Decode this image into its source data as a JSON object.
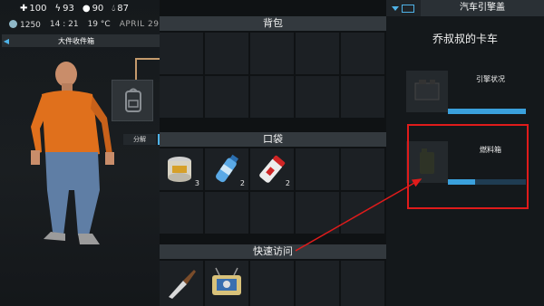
{
  "hud": {
    "health": "100",
    "energy": "93",
    "food": "90",
    "water": "87",
    "coins": "1250",
    "time": "14 : 21",
    "temperature": "19 °C",
    "date": "APRIL 29"
  },
  "icons": {
    "health": "plus-icon",
    "energy": "lightning-icon",
    "food": "apple-icon",
    "water": "water-drop-icon",
    "coins": "coin-icon"
  },
  "left": {
    "container_label": "大件收件箱",
    "split_label": "分解"
  },
  "inventory": {
    "backpack_title": "背包",
    "pockets_title": "口袋",
    "pockets_items": [
      {
        "name": "canned-food",
        "qty": "3"
      },
      {
        "name": "water-bottle",
        "qty": "2"
      },
      {
        "name": "spray-can",
        "qty": "2"
      }
    ],
    "quick_access_title": "快速访问",
    "quick_items": [
      "knife",
      "radio"
    ]
  },
  "vehicle": {
    "tab_title": "汽车引擎盖",
    "truck_name": "乔叔叔的卡车",
    "parts": [
      {
        "name": "引擎状况",
        "level": 1.0
      },
      {
        "name": "燃料箱",
        "level": 0.35
      }
    ]
  },
  "colors": {
    "accent": "#4fb3e8",
    "highlight": "#e01b1b",
    "panel": "#1c2024"
  }
}
